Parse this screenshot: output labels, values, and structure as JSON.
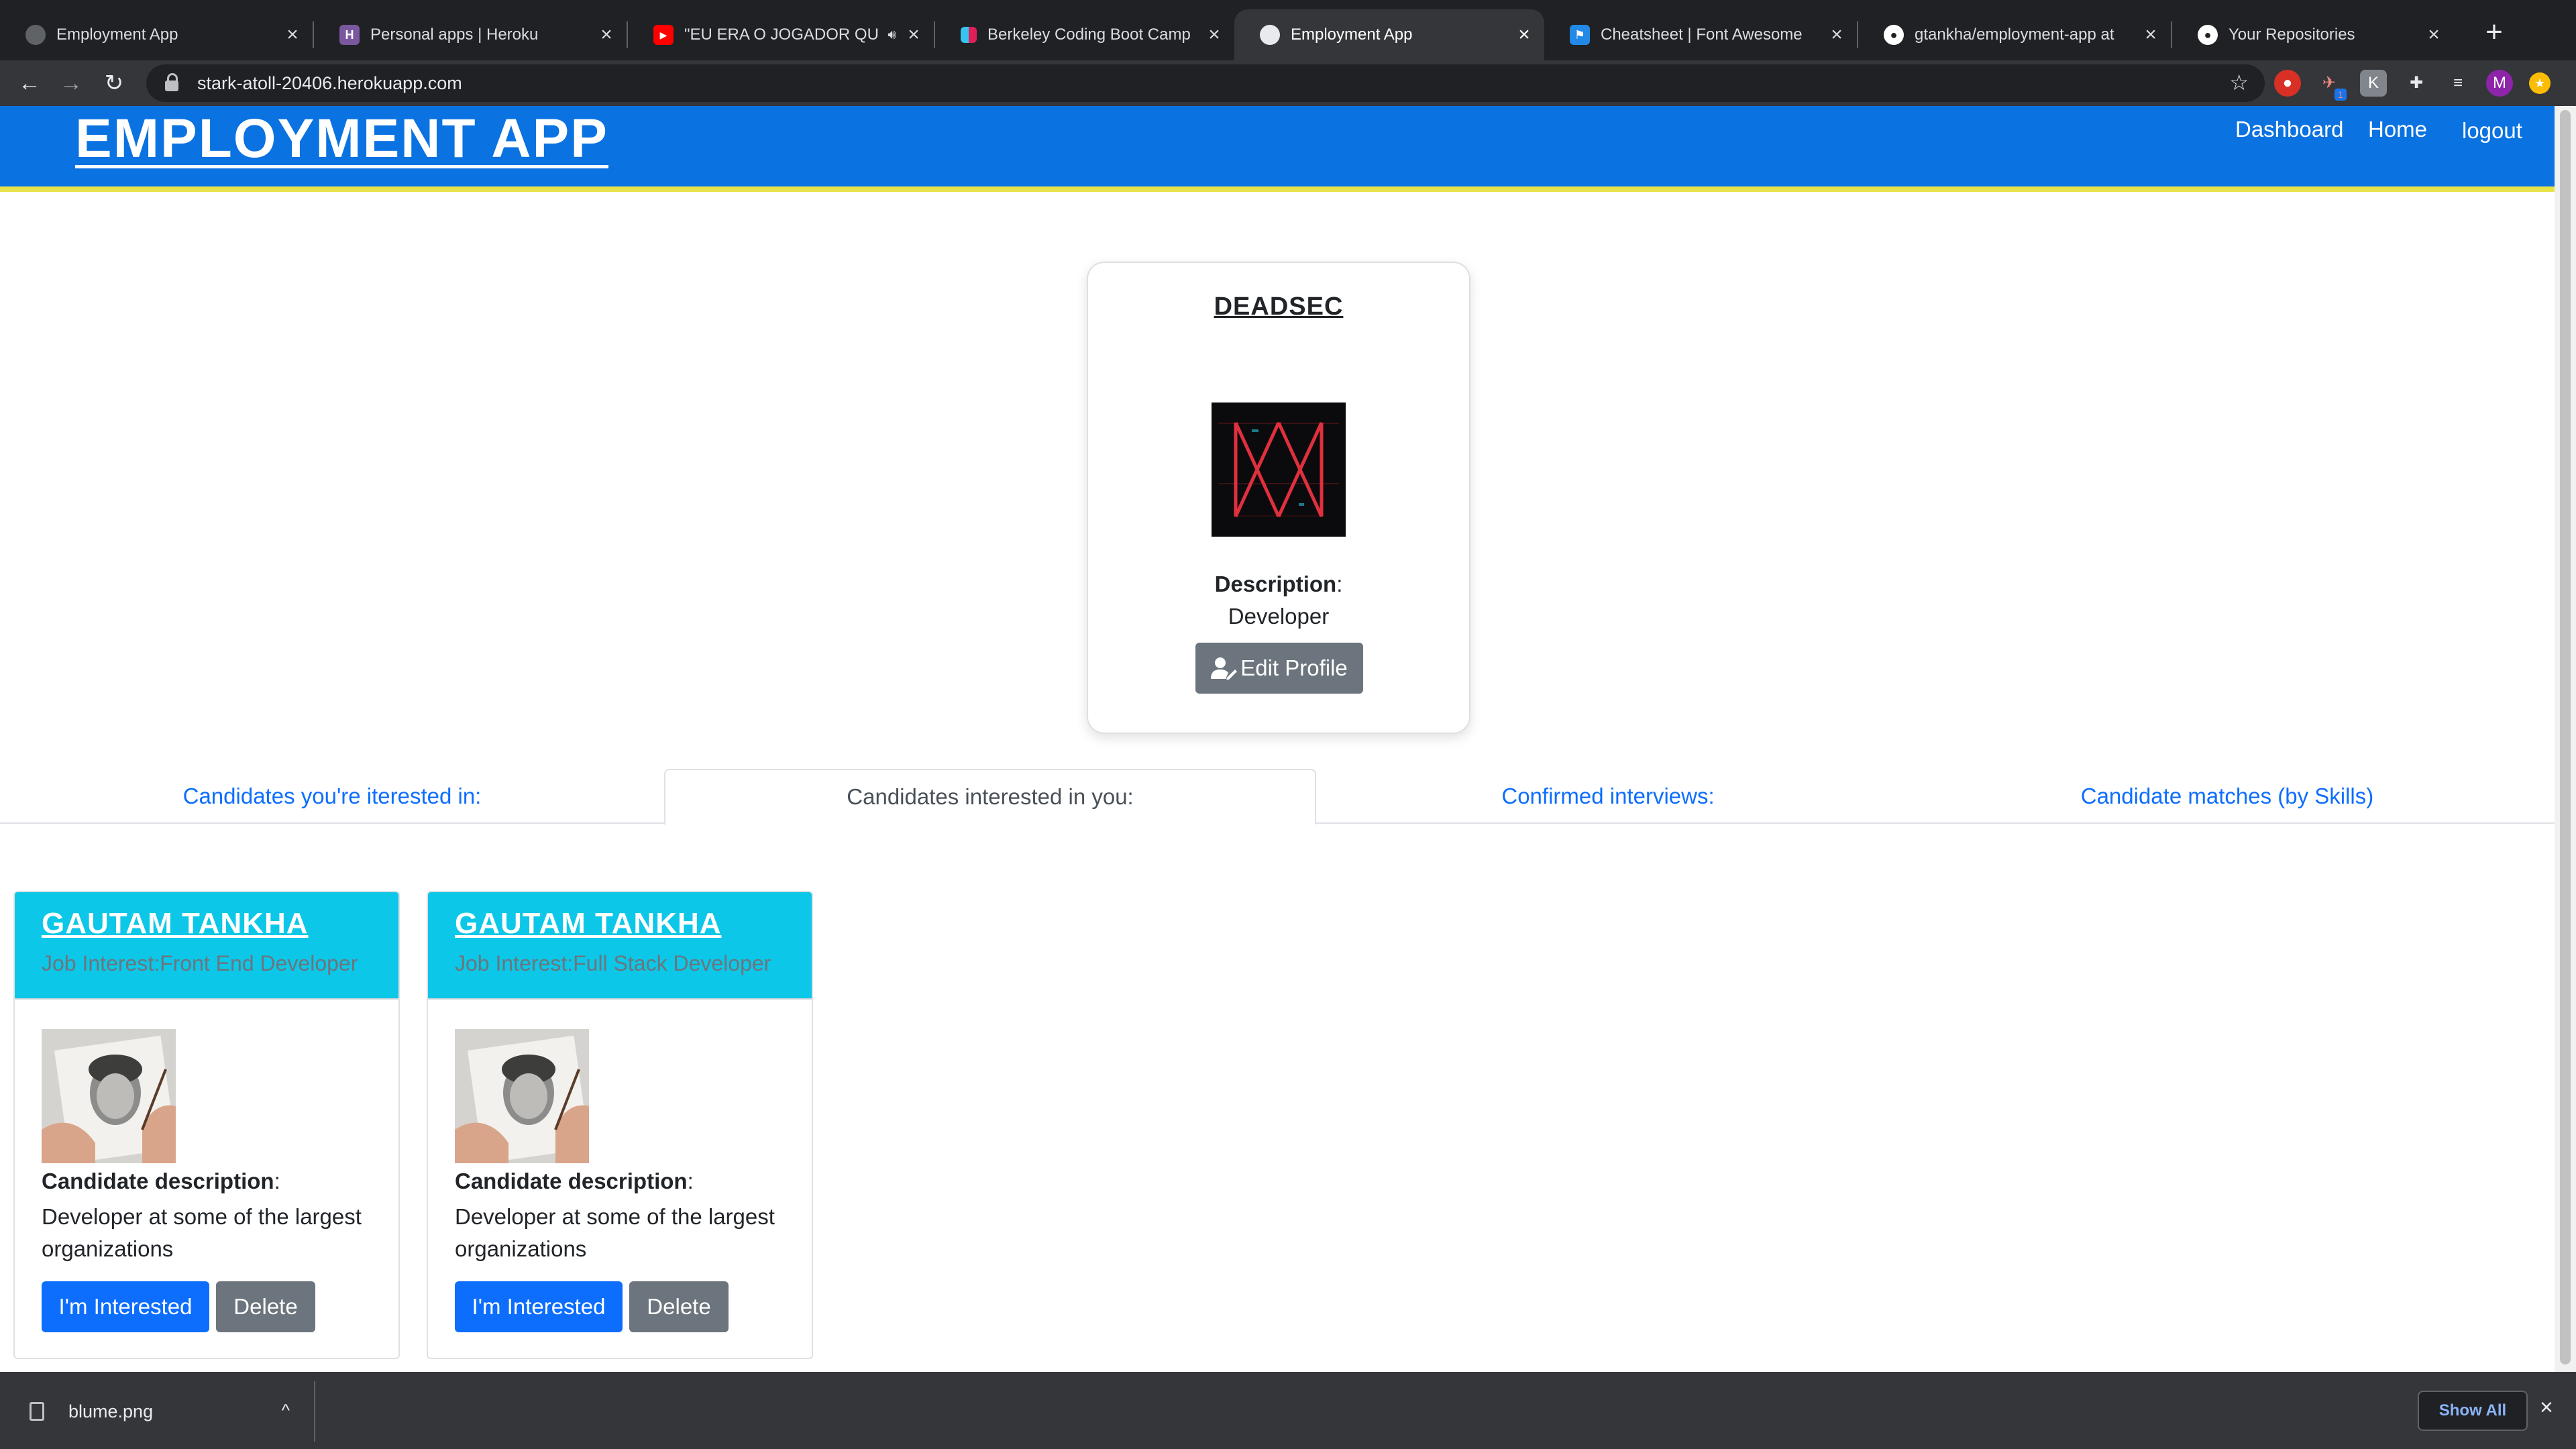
{
  "browser": {
    "tabs": [
      {
        "title": "Employment App",
        "icon": "globe-icon",
        "active": false
      },
      {
        "title": "Personal apps | Heroku",
        "icon": "heroku-icon",
        "active": false
      },
      {
        "title": "\"EU ERA O JOGADOR QU",
        "icon": "youtube-icon",
        "active": false
      },
      {
        "title": "Berkeley Coding Boot Camp",
        "icon": "slack-icon",
        "active": false
      },
      {
        "title": "Employment App",
        "icon": "globe-icon",
        "active": true
      },
      {
        "title": "Cheatsheet | Font Awesome",
        "icon": "font-awesome-icon",
        "active": false
      },
      {
        "title": "gtankha/employment-app at",
        "icon": "github-icon",
        "active": false
      },
      {
        "title": "Your Repositories",
        "icon": "github-icon",
        "active": false
      }
    ],
    "url": "stark-atoll-20406.herokuapp.com",
    "profile_initial": "M",
    "extension_badge": "1"
  },
  "header": {
    "title": "EMPLOYMENT APP",
    "nav": [
      "Dashboard",
      "Home",
      "logout"
    ]
  },
  "profile": {
    "name": "DEADSEC",
    "description_label": "Description",
    "description": "Developer",
    "edit_label": "Edit Profile"
  },
  "tabs": [
    {
      "label": "Candidates you're iterested in:",
      "active": false
    },
    {
      "label": "Candidates interested in you:",
      "active": true
    },
    {
      "label": "Confirmed interviews:",
      "active": false
    },
    {
      "label": "Candidate matches (by Skills)",
      "active": false
    }
  ],
  "candidates": [
    {
      "name": "GAUTAM TANKHA",
      "job_interest": "Job Interest:Front End Developer",
      "description_label": "Candidate description",
      "description": "Developer at some of the largest organizations",
      "interested_label": "I'm Interested",
      "delete_label": "Delete"
    },
    {
      "name": "GAUTAM TANKHA",
      "job_interest": "Job Interest:Full Stack Developer",
      "description_label": "Candidate description",
      "description": "Developer at some of the largest organizations",
      "interested_label": "I'm Interested",
      "delete_label": "Delete"
    }
  ],
  "downloads": {
    "file": "blume.png",
    "show_all_label": "Show All"
  },
  "colors": {
    "header_blue": "#0a72e1",
    "header_border_yellow": "#e7e34a",
    "card_header_cyan": "#0dc7e8",
    "primary_button": "#0d6efd",
    "secondary_button": "#6c757d"
  }
}
